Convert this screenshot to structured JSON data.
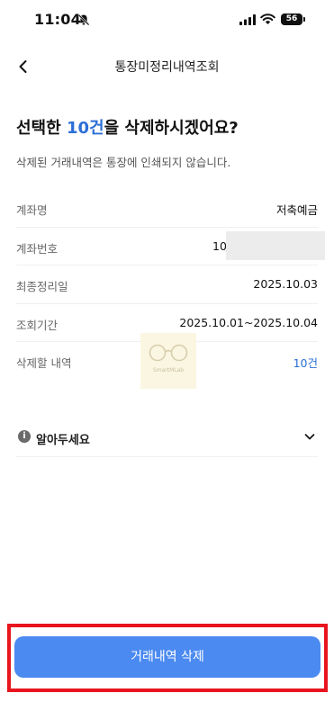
{
  "status_bar": {
    "time": "11:04",
    "battery": "56"
  },
  "nav": {
    "title": "통장미정리내역조회"
  },
  "heading": {
    "prefix": "선택한 ",
    "count": "10건",
    "suffix": "을 삭제하시겠어요?"
  },
  "subtext": "삭제된 거래내역은 통장에 인쇄되지 않습니다.",
  "info_rows": [
    {
      "label": "계좌명",
      "value": "저축예금"
    },
    {
      "label": "계좌번호",
      "value": "10"
    },
    {
      "label": "최종정리일",
      "value": "2025.10.03"
    },
    {
      "label": "조회기간",
      "value": "2025.10.01~2025.10.04"
    },
    {
      "label": "삭제할 내역",
      "value": "10건"
    }
  ],
  "watermark": {
    "text": "SmartMLab"
  },
  "notice": {
    "icon_glyph": "i",
    "label": "알아두세요"
  },
  "button": {
    "label": "거래내역 삭제"
  },
  "colors": {
    "accent": "#2b6fd6",
    "button": "#4b8af0",
    "highlight": "#e8141e"
  }
}
